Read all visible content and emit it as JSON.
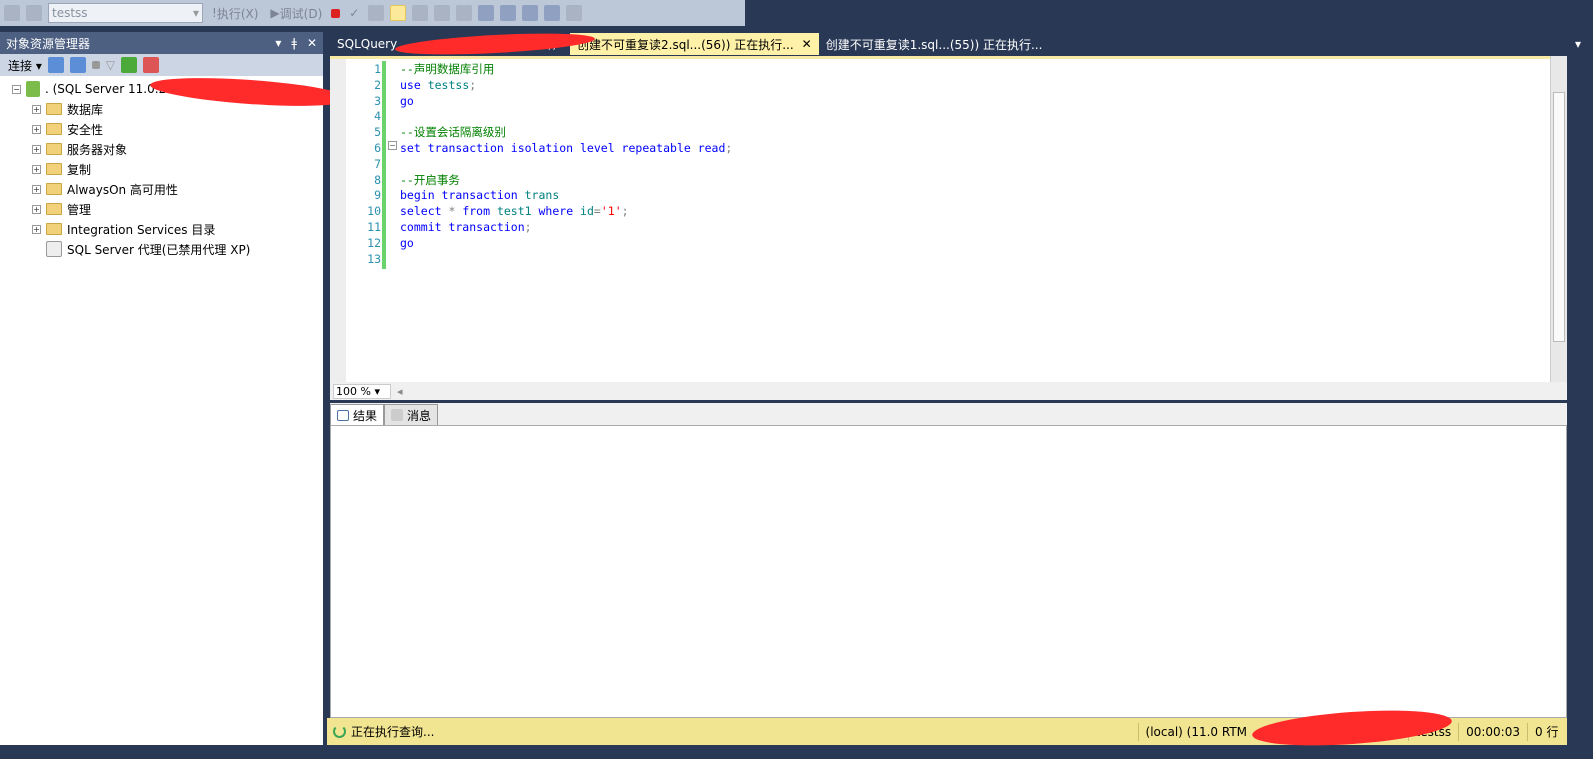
{
  "toolbar": {
    "database": "testss",
    "execute": "执行(X)",
    "debug": "调试(D)"
  },
  "object_explorer": {
    "title": "对象资源管理器",
    "connect": "连接",
    "server": ". (SQL Server 11.0.210",
    "nodes": [
      "数据库",
      "安全性",
      "服务器对象",
      "复制",
      "AlwaysOn 高可用性",
      "管理",
      "Integration Services 目录"
    ],
    "agent": "SQL Server 代理(已禁用代理 XP)"
  },
  "tabs": [
    {
      "label": "SQLQuery",
      "suffix": "))*"
    },
    {
      "label": "创建不可重复读2.sql...(56)) 正在执行...",
      "active": true
    },
    {
      "label": "创建不可重复读1.sql...(55)) 正在执行..."
    }
  ],
  "editor": {
    "lines": [
      [
        [
          "cm",
          "--声明数据库引用"
        ]
      ],
      [
        [
          "kw",
          "use "
        ],
        [
          "id",
          "testss"
        ],
        [
          "gr",
          ";"
        ]
      ],
      [
        [
          "kw",
          "go"
        ]
      ],
      [],
      [
        [
          "cm",
          "--设置会话隔离级别"
        ]
      ],
      [
        [
          "kw",
          "set transaction isolation level repeatable read"
        ],
        [
          "gr",
          ";"
        ]
      ],
      [],
      [
        [
          "cm",
          "--开启事务"
        ]
      ],
      [
        [
          "kw",
          "begin transaction "
        ],
        [
          "id",
          "trans"
        ]
      ],
      [
        [
          "kw",
          "select "
        ],
        [
          "gr",
          "* "
        ],
        [
          "kw",
          "from "
        ],
        [
          "id",
          "test1 "
        ],
        [
          "kw",
          "where "
        ],
        [
          "id",
          "id"
        ],
        [
          "gr",
          "="
        ],
        [
          "st",
          "'1'"
        ],
        [
          "gr",
          ";"
        ]
      ],
      [
        [
          "kw",
          "commit transaction"
        ],
        [
          "gr",
          ";"
        ]
      ],
      [
        [
          "kw",
          "go"
        ]
      ],
      []
    ]
  },
  "zoom": "100 %",
  "result_tabs": [
    "结果",
    "消息"
  ],
  "status": {
    "message": "正在执行查询...",
    "server": "(local) (11.0 RTM",
    "database": "testss",
    "elapsed": "00:00:03",
    "rows": "0 行"
  },
  "colors": {
    "keyword": "#0000ff",
    "comment": "#008000",
    "status_bar": "#f2e592",
    "chrome": "#293955"
  }
}
